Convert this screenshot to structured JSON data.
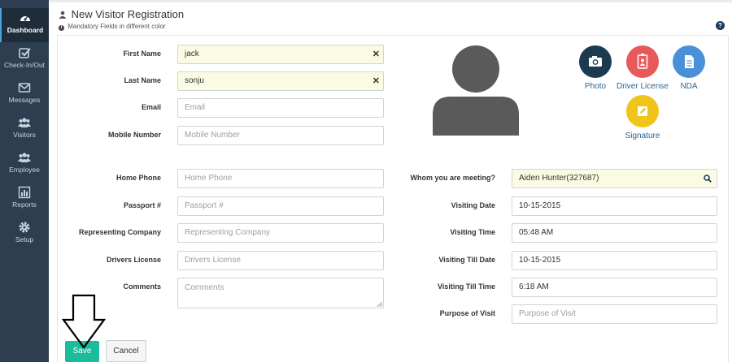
{
  "sidebar": {
    "items": [
      {
        "label": "Dashboard",
        "icon": "dashboard-icon"
      },
      {
        "label": "Check-In/Out",
        "icon": "check-square-icon"
      },
      {
        "label": "Messages",
        "icon": "envelope-icon"
      },
      {
        "label": "Visitors",
        "icon": "users-icon"
      },
      {
        "label": "Employee",
        "icon": "users-icon"
      },
      {
        "label": "Reports",
        "icon": "bar-chart-icon"
      },
      {
        "label": "Setup",
        "icon": "gear-icon"
      }
    ]
  },
  "header": {
    "title": "New Visitor Registration",
    "subtitle": "Mandatory Fields in different color",
    "help": "?"
  },
  "form_left": {
    "first_name": {
      "label": "First Name",
      "value": "jack"
    },
    "last_name": {
      "label": "Last Name",
      "value": "sonju"
    },
    "email": {
      "label": "Email",
      "placeholder": "Email"
    },
    "mobile": {
      "label": "Mobile Number",
      "placeholder": "Mobile Number"
    },
    "home_phone": {
      "label": "Home Phone",
      "placeholder": "Home Phone"
    },
    "passport": {
      "label": "Passport #",
      "placeholder": "Passport #"
    },
    "company": {
      "label": "Representing Company",
      "placeholder": "Representing Company"
    },
    "drivers_license": {
      "label": "Drivers License",
      "placeholder": "Drivers License"
    },
    "comments": {
      "label": "Comments",
      "placeholder": "Comments"
    }
  },
  "form_right": {
    "meeting": {
      "label": "Whom you are meeting?",
      "value": "Aiden Hunter(327687)"
    },
    "visiting_date": {
      "label": "Visiting Date",
      "value": "10-15-2015"
    },
    "visiting_time": {
      "label": "Visiting Time",
      "value": "05:48 AM"
    },
    "till_date": {
      "label": "Visiting Till Date",
      "value": "10-15-2015"
    },
    "till_time": {
      "label": "Visiting Till Time",
      "value": "6:18 AM"
    },
    "purpose": {
      "label": "Purpose of Visit",
      "placeholder": "Purpose of Visit"
    }
  },
  "capture": {
    "photo": {
      "label": "Photo",
      "color": "#1d3b4f"
    },
    "driver_license": {
      "label": "Driver License",
      "color": "#e85a5a"
    },
    "nda": {
      "label": "NDA",
      "color": "#4a90d9"
    },
    "signature": {
      "label": "Signature",
      "color": "#f0c419"
    }
  },
  "buttons": {
    "save": "Save",
    "cancel": "Cancel"
  },
  "colors": {
    "sidebar_bg": "#2c3e50",
    "mandatory_bg": "#fbfbe3",
    "save_bg": "#1abc9c"
  }
}
